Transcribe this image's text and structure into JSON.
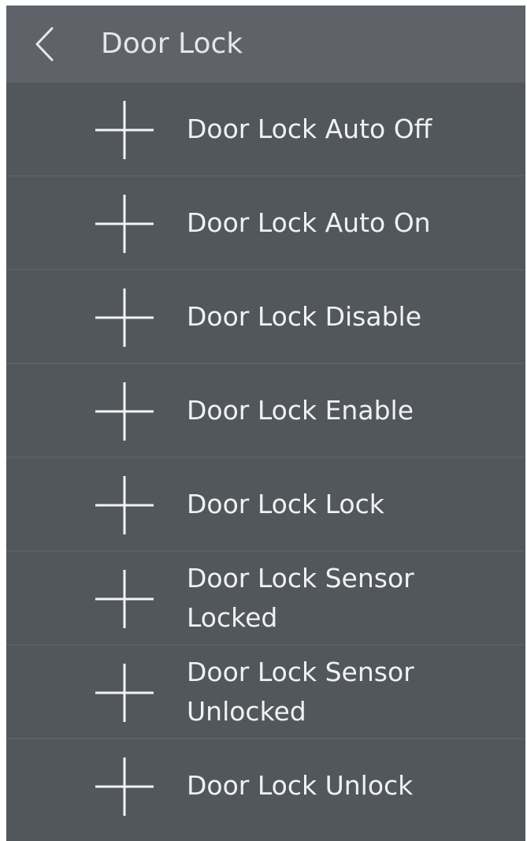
{
  "header": {
    "back_icon": "chevron-left-icon",
    "title": "Door Lock"
  },
  "list": {
    "item_icon": "plus-icon",
    "items": [
      {
        "label": "Door Lock Auto Off"
      },
      {
        "label": "Door Lock Auto On"
      },
      {
        "label": "Door Lock Disable"
      },
      {
        "label": "Door Lock Enable"
      },
      {
        "label": "Door Lock Lock"
      },
      {
        "label": "Door Lock Sensor Locked"
      },
      {
        "label": "Door Lock Sensor Unlocked"
      },
      {
        "label": "Door Lock Unlock"
      }
    ]
  },
  "colors": {
    "header_bg": "#5f6369",
    "list_bg": "#52575c",
    "text": "#f0f1f2",
    "divider": "#5b6066"
  }
}
